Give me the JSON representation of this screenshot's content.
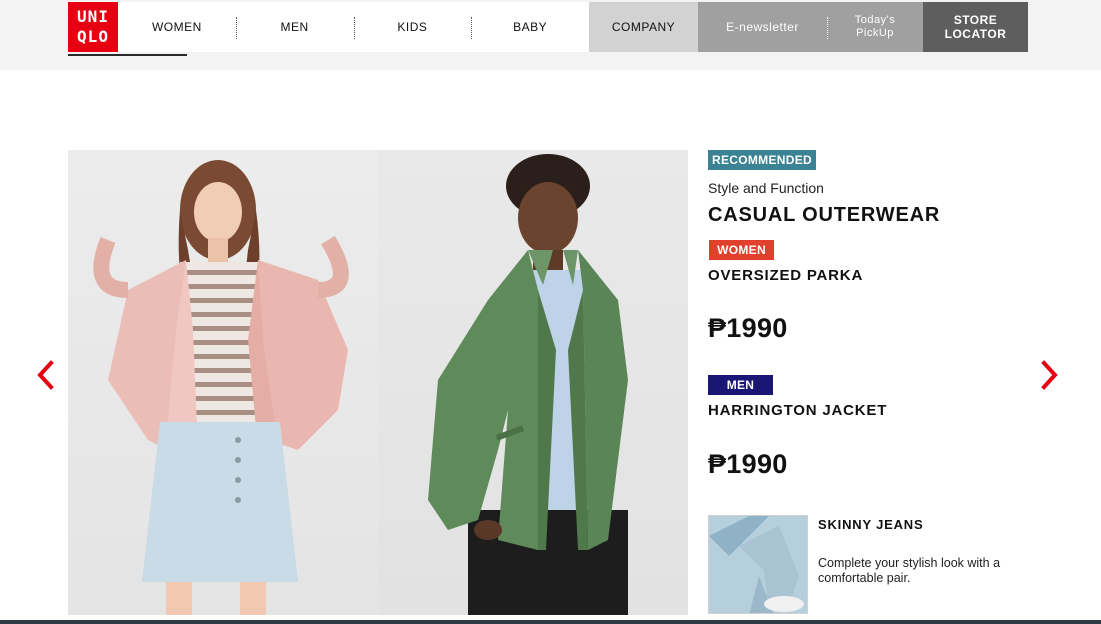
{
  "brand": {
    "logo_line1": "UNI",
    "logo_line2": "QLO",
    "color": "#e60012"
  },
  "nav": {
    "items": [
      {
        "label": "WOMEN"
      },
      {
        "label": "MEN"
      },
      {
        "label": "KIDS"
      },
      {
        "label": "BABY"
      }
    ],
    "company": "COMPANY",
    "enewsletter": "E-newsletter",
    "today_line1": "Today's",
    "today_line2": "PickUp",
    "store_line1": "STORE",
    "store_line2": "LOCATOR"
  },
  "feature": {
    "badge": "RECOMMENDED",
    "badge_color": "#3b8294",
    "subtitle": "Style and Function",
    "headline": "CASUAL OUTERWEAR",
    "products": [
      {
        "badge": "WOMEN",
        "badge_color": "#e0402c",
        "name": "OVERSIZED PARKA",
        "price": "₱1990"
      },
      {
        "badge": "MEN",
        "badge_color": "#1a1676",
        "name": "HARRINGTON JACKET",
        "price": "₱1990"
      }
    ],
    "promo": {
      "title": "SKINNY JEANS",
      "description": "Complete your stylish look with a comfortable pair."
    }
  },
  "icons": {
    "prev": "chevron-left-icon",
    "next": "chevron-right-icon",
    "arrow_color": "#e60012"
  }
}
